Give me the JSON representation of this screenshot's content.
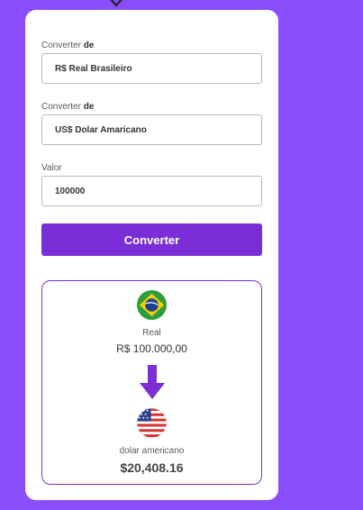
{
  "form": {
    "from": {
      "label_prefix": "Converter ",
      "label_bold": "de",
      "value": "R$ Real Brasileiro"
    },
    "to": {
      "label_prefix": "Converter ",
      "label_bold": "de",
      "value": "US$ Dolar Amaricano"
    },
    "amount": {
      "label": "Valor",
      "value": "100000"
    },
    "convert_button": "Converter"
  },
  "result": {
    "source_name": "Real",
    "source_value": "R$ 100.000,00",
    "target_name": "dolar americano",
    "target_value": "$20,408.16"
  },
  "colors": {
    "background": "#8a4dfc",
    "accent": "#7a2fd6"
  },
  "icons": {
    "source_flag": "brazil-flag-icon",
    "target_flag": "usa-flag-icon",
    "arrow": "arrow-down-icon",
    "top": "chevron-down-icon"
  }
}
